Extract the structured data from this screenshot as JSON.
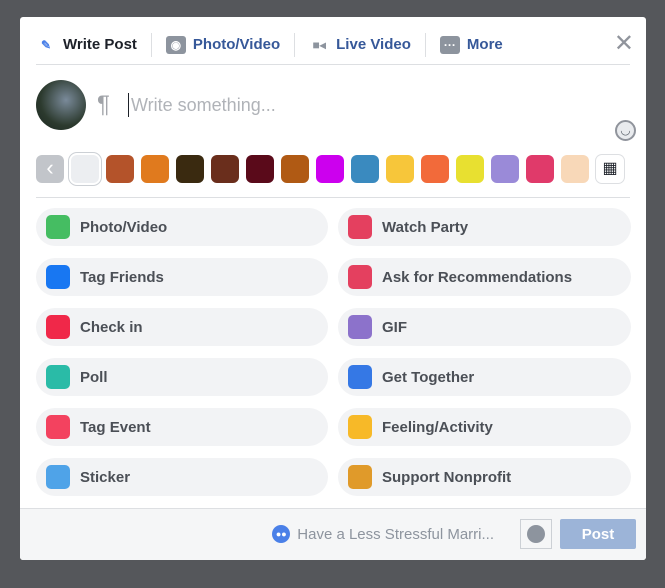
{
  "tabs": [
    {
      "label": "Write Post",
      "icon": "pencil-icon"
    },
    {
      "label": "Photo/Video",
      "icon": "camera-icon"
    },
    {
      "label": "Live Video",
      "icon": "video-camera-icon"
    },
    {
      "label": "More",
      "icon": "more-icon"
    }
  ],
  "composer": {
    "placeholder": "Write something..."
  },
  "swatch_colors": [
    "#c2c5ca",
    "#eceef1",
    "#b4532a",
    "#e07a1e",
    "#3a2a10",
    "#6a2e1c",
    "#5a0a1a",
    "#b05a14",
    "#cc00ee",
    "#3a8abf",
    "#f7c63a",
    "#f26a3a",
    "#e8e030",
    "#9a8ad8",
    "#e03a6a",
    "#f8d8b8",
    "#ffffff"
  ],
  "options": [
    {
      "label": "Photo/Video",
      "icon": "photo-icon",
      "color": "#45bd62"
    },
    {
      "label": "Watch Party",
      "icon": "popcorn-icon",
      "color": "#e4405f"
    },
    {
      "label": "Tag Friends",
      "icon": "tag-friends-icon",
      "color": "#1877f2"
    },
    {
      "label": "Ask for Recommendations",
      "icon": "recommendations-icon",
      "color": "#e4405f"
    },
    {
      "label": "Check in",
      "icon": "location-pin-icon",
      "color": "#f02849"
    },
    {
      "label": "GIF",
      "icon": "gif-icon",
      "color": "#8c72cb"
    },
    {
      "label": "Poll",
      "icon": "poll-icon",
      "color": "#2abba7"
    },
    {
      "label": "Get Together",
      "icon": "wave-hand-icon",
      "color": "#3578e5"
    },
    {
      "label": "Tag Event",
      "icon": "calendar-icon",
      "color": "#f3425f"
    },
    {
      "label": "Feeling/Activity",
      "icon": "smiley-icon",
      "color": "#f7b928"
    },
    {
      "label": "Sticker",
      "icon": "sticker-icon",
      "color": "#4fa3e8"
    },
    {
      "label": "Support Nonprofit",
      "icon": "heart-icon",
      "color": "#e09a2a"
    }
  ],
  "footer": {
    "audience": "Have a Less Stressful Marri...",
    "post_label": "Post"
  }
}
